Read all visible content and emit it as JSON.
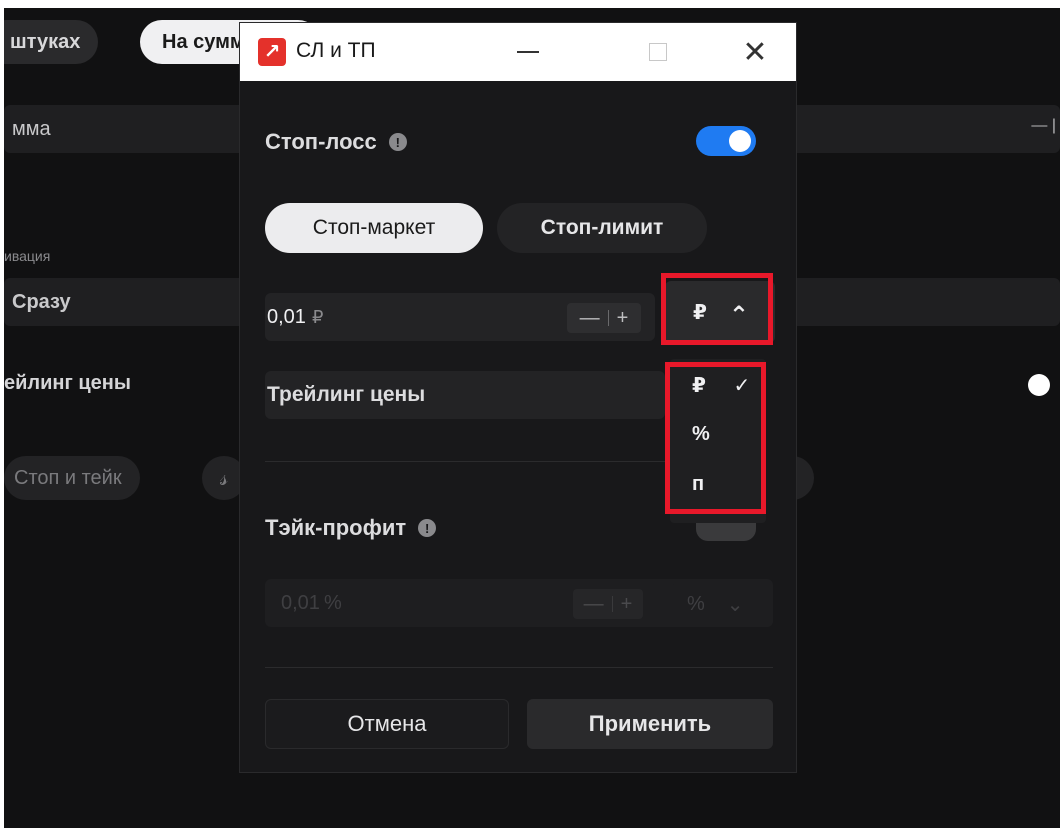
{
  "background": {
    "pill_pieces": "штуках",
    "pill_sum": "На сумме",
    "field_sum": "мма",
    "label_activation": "ивация",
    "field_immediately": "Сразу",
    "text_trailing": "ейлинг цены",
    "pill_stop_take": "Стоп и тейк",
    "link_icon_glyph": "𝓈",
    "stepper_minus": "— |"
  },
  "window": {
    "title": "СЛ и ТП",
    "app_icon": "↗"
  },
  "stop_loss": {
    "title": "Стоп-лосс",
    "info": "!",
    "enabled": true,
    "order_types": [
      "Стоп-маркет",
      "Стоп-лимит"
    ],
    "selected_order_type": "Стоп-маркет",
    "value": "0,01",
    "value_unit": "₽",
    "stepper_minus": "—",
    "stepper_plus": "+",
    "unit_selected": "₽",
    "unit_chevron": "⌃",
    "unit_options": [
      {
        "label": "₽",
        "check": "✓"
      },
      {
        "label": "%",
        "check": ""
      },
      {
        "label": "п",
        "check": ""
      }
    ],
    "trailing_label": "Трейлинг цены"
  },
  "take_profit": {
    "title": "Тэйк-профит",
    "info": "!",
    "enabled": false,
    "value": "0,01",
    "value_unit": "%",
    "stepper_minus": "—",
    "stepper_plus": "+",
    "unit_selected": "%",
    "unit_chevron": "⌄"
  },
  "actions": {
    "cancel": "Отмена",
    "apply": "Применить"
  },
  "colors": {
    "accent_toggle": "#1f7bf2",
    "highlight": "#e8182a",
    "app_icon": "#e4312b"
  }
}
